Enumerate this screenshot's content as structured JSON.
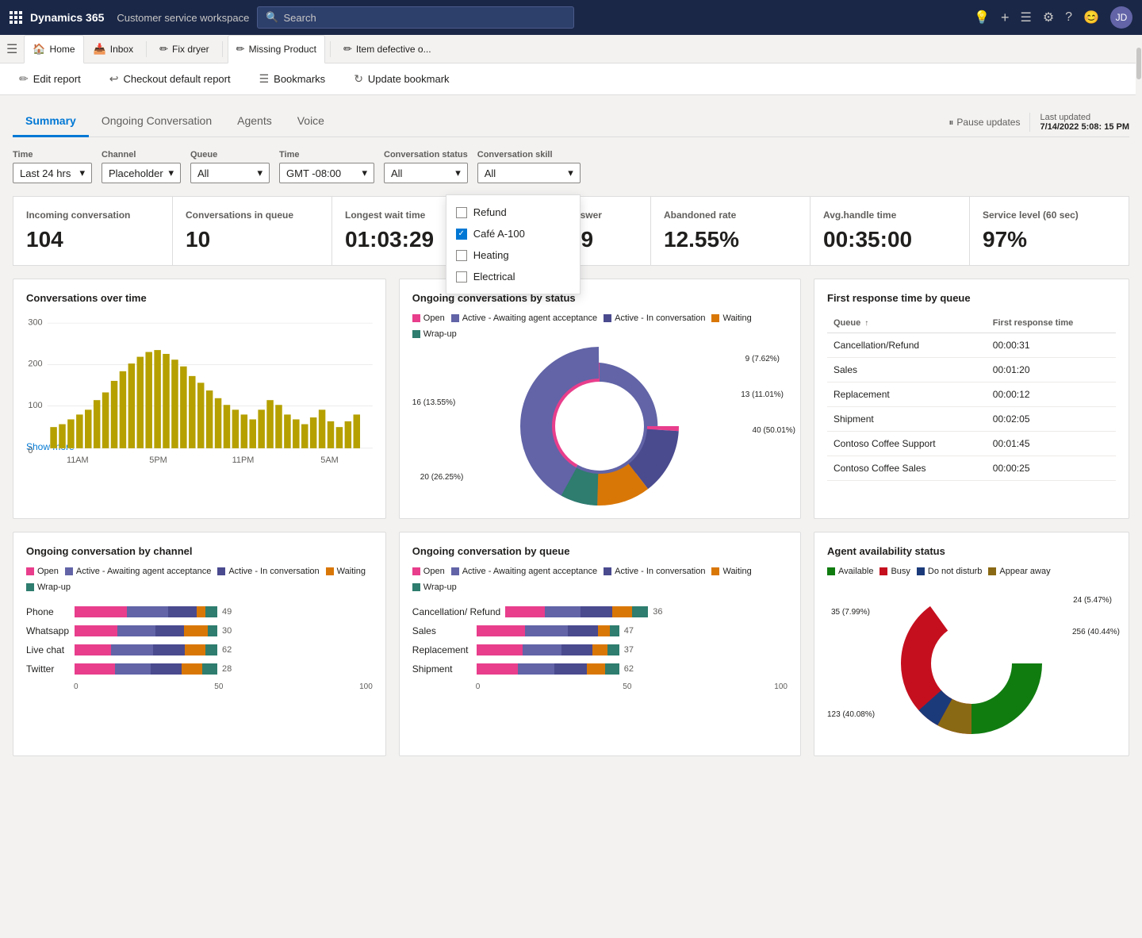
{
  "app": {
    "brand": "Dynamics 365",
    "module": "Customer service workspace"
  },
  "search": {
    "placeholder": "Search"
  },
  "tabs": [
    {
      "id": "home",
      "label": "Home",
      "icon": "🏠",
      "active": false
    },
    {
      "id": "inbox",
      "label": "Inbox",
      "icon": "📥",
      "active": false
    },
    {
      "id": "fix-dryer",
      "label": "Fix dryer",
      "icon": "✏️",
      "active": false
    },
    {
      "id": "missing-product",
      "label": "Missing Product",
      "icon": "✏️",
      "active": true
    },
    {
      "id": "item-defective",
      "label": "Item defective o...",
      "icon": "✏️",
      "active": false
    }
  ],
  "toolbar": {
    "edit_report": "Edit report",
    "checkout_default_report": "Checkout default report",
    "bookmarks": "Bookmarks",
    "update_bookmark": "Update bookmark"
  },
  "summary_tabs": [
    {
      "id": "summary",
      "label": "Summary",
      "active": true
    },
    {
      "id": "ongoing",
      "label": "Ongoing Conversation",
      "active": false
    },
    {
      "id": "agents",
      "label": "Agents",
      "active": false
    },
    {
      "id": "voice",
      "label": "Voice",
      "active": false
    }
  ],
  "pause_updates": "Pause updates",
  "last_updated_label": "Last updated",
  "last_updated_value": "7/14/2022 5:08: 15 PM",
  "filters": {
    "time": {
      "label": "Time",
      "value": "Last 24 hrs"
    },
    "channel": {
      "label": "Channel",
      "value": "Placeholder"
    },
    "queue": {
      "label": "Queue",
      "value": "All"
    },
    "time2": {
      "label": "Time",
      "value": "GMT -08:00"
    },
    "conv_status": {
      "label": "Conversation status",
      "value": "All"
    },
    "conv_skill": {
      "label": "Conversation skill",
      "value": "All",
      "options": [
        {
          "id": "refund",
          "label": "Refund",
          "checked": false
        },
        {
          "id": "cafe-a-100",
          "label": "Café A-100",
          "checked": true
        },
        {
          "id": "heating",
          "label": "Heating",
          "checked": false
        },
        {
          "id": "electrical",
          "label": "Electrical",
          "checked": false
        }
      ]
    }
  },
  "kpis": [
    {
      "label": "Incoming conversation",
      "value": "104"
    },
    {
      "label": "Conversations in queue",
      "value": "10"
    },
    {
      "label": "Longest wait time",
      "value": "01:03:29"
    },
    {
      "label": "Avg. speed to answer",
      "value": "00:09:19"
    },
    {
      "label": "Abandoned rate",
      "value": "12.55%"
    },
    {
      "label": "Avg.handle time",
      "value": "00:35:00"
    },
    {
      "label": "Service level (60 sec)",
      "value": "97%"
    }
  ],
  "charts": {
    "conversations_over_time": {
      "title": "Conversations over time",
      "y_labels": [
        "300",
        "200",
        "100",
        "0"
      ],
      "x_labels": [
        "11AM",
        "5PM",
        "11PM",
        "5AM"
      ],
      "show_more": "Show more"
    },
    "ongoing_by_status": {
      "title": "Ongoing conversations by status",
      "legend": [
        {
          "label": "Open",
          "color": "#e83e8c"
        },
        {
          "label": "Active - Awaiting agent acceptance",
          "color": "#6264a7"
        },
        {
          "label": "Active - In conversation",
          "color": "#4a4a8f"
        },
        {
          "label": "Waiting",
          "color": "#d97706"
        },
        {
          "label": "Wrap-up",
          "color": "#2e7d6e"
        }
      ],
      "segments": [
        {
          "label": "40 (50.01%)",
          "value": 50.01,
          "color": "#6264a7"
        },
        {
          "label": "20 (26.25%)",
          "value": 26.25,
          "color": "#e83e8c"
        },
        {
          "label": "16 (13.55%)",
          "value": 13.55,
          "color": "#4a4a8f"
        },
        {
          "label": "13 (11.01%)",
          "value": 11.01,
          "color": "#d97706"
        },
        {
          "label": "9 (7.62%)",
          "value": 7.62,
          "color": "#2e7d6e"
        }
      ]
    },
    "first_response_by_queue": {
      "title": "First response time by queue",
      "columns": [
        "Queue",
        "First response time"
      ],
      "rows": [
        {
          "queue": "Cancellation/Refund",
          "time": "00:00:31"
        },
        {
          "queue": "Sales",
          "time": "00:01:20"
        },
        {
          "queue": "Replacement",
          "time": "00:00:12"
        },
        {
          "queue": "Shipment",
          "time": "00:02:05"
        },
        {
          "queue": "Contoso Coffee Support",
          "time": "00:01:45"
        },
        {
          "queue": "Contoso Coffee Sales",
          "time": "00:00:25"
        }
      ]
    },
    "ongoing_by_channel": {
      "title": "Ongoing conversation by channel",
      "legend": [
        {
          "label": "Open",
          "color": "#e83e8c"
        },
        {
          "label": "Active - Awaiting agent acceptance",
          "color": "#6264a7"
        },
        {
          "label": "Active - In conversation",
          "color": "#4a4a8f"
        },
        {
          "label": "Waiting",
          "color": "#d97706"
        },
        {
          "label": "Wrap-up",
          "color": "#2e7d6e"
        }
      ],
      "x_max": 100,
      "rows": [
        {
          "label": "Phone",
          "segments": [
            18,
            14,
            10,
            3,
            4
          ],
          "total": 49
        },
        {
          "label": "Whatsapp",
          "segments": [
            9,
            8,
            6,
            5,
            2
          ],
          "total": 30
        },
        {
          "label": "Live chat",
          "segments": [
            16,
            18,
            14,
            9,
            5
          ],
          "total": 62
        },
        {
          "label": "Twitter",
          "segments": [
            8,
            7,
            6,
            4,
            3
          ],
          "total": 28
        }
      ]
    },
    "ongoing_by_queue": {
      "title": "Ongoing conversation by queue",
      "legend": [
        {
          "label": "Open",
          "color": "#e83e8c"
        },
        {
          "label": "Active - Awaiting agent acceptance",
          "color": "#6264a7"
        },
        {
          "label": "Active - In conversation",
          "color": "#4a4a8f"
        },
        {
          "label": "Waiting",
          "color": "#d97706"
        },
        {
          "label": "Wrap-up",
          "color": "#2e7d6e"
        }
      ],
      "x_max": 100,
      "rows": [
        {
          "label": "Cancellation/ Refund",
          "segments": [
            10,
            9,
            8,
            5,
            4
          ],
          "total": 36
        },
        {
          "label": "Sales",
          "segments": [
            16,
            14,
            10,
            4,
            3
          ],
          "total": 47
        },
        {
          "label": "Replacement",
          "segments": [
            12,
            10,
            8,
            4,
            3
          ],
          "total": 37
        },
        {
          "label": "Shipment",
          "segments": [
            18,
            16,
            14,
            8,
            6
          ],
          "total": 62
        }
      ]
    },
    "agent_availability": {
      "title": "Agent availability status",
      "legend": [
        {
          "label": "Available",
          "color": "#107c10"
        },
        {
          "label": "Busy",
          "color": "#c50f1f"
        },
        {
          "label": "Do not disturb",
          "color": "#1b3a7a"
        },
        {
          "label": "Appear away",
          "color": "#8a6914"
        }
      ],
      "segments": [
        {
          "label": "256 (40.44%)",
          "value": 40.44,
          "color": "#c50f1f"
        },
        {
          "label": "123 (40.08%)",
          "value": 40.08,
          "color": "#107c10"
        },
        {
          "label": "35 (7.99%)",
          "value": 7.99,
          "color": "#8a6914"
        },
        {
          "label": "24 (5.47%)",
          "value": 5.47,
          "color": "#1b3a7a"
        }
      ]
    }
  }
}
